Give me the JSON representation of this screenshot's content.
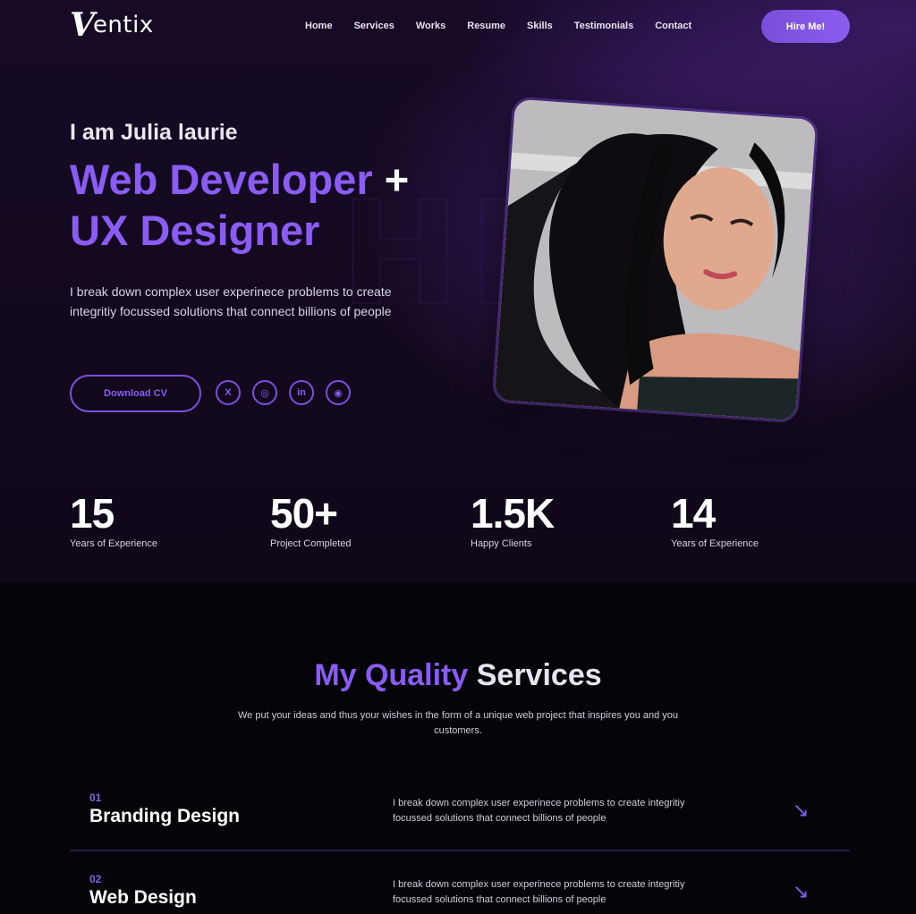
{
  "brand": {
    "logo_mark": "V",
    "logo_text": "entix"
  },
  "nav": {
    "items": [
      "Home",
      "Services",
      "Works",
      "Resume",
      "Skills",
      "Testimonials",
      "Contact"
    ],
    "cta": "Hire Me!"
  },
  "hero": {
    "intro": "I am Julia laurie",
    "headline_line1": "Web Developer",
    "headline_plus": "+",
    "headline_line2": "UX Designer",
    "description": "I break down complex user experinece problems to create integritiy focussed solutions that connect billions of people",
    "cv_button": "Download CV",
    "socials": [
      {
        "icon": "x-icon",
        "glyph": "X"
      },
      {
        "icon": "dribbble-icon",
        "glyph": "◎"
      },
      {
        "icon": "linkedin-icon",
        "glyph": "in"
      },
      {
        "icon": "github-icon",
        "glyph": "◉"
      }
    ],
    "photo_alt": "Portrait photo"
  },
  "stats": [
    {
      "value": "15",
      "label": "Years of Experience"
    },
    {
      "value": "50+",
      "label": "Project Completed"
    },
    {
      "value": "1.5K",
      "label": "Happy Clients"
    },
    {
      "value": "14",
      "label": "Years of Experience"
    }
  ],
  "services": {
    "title_accent": "My Quality",
    "title_rest": "Services",
    "subtitle": "We put your ideas and thus your wishes in the form of a unique web project that inspires you and you customers.",
    "items": [
      {
        "num": "01",
        "title": "Branding Design",
        "desc": "I break down complex user experinece problems to create integritiy focussed solutions that connect billions of people",
        "arrow": "↘"
      },
      {
        "num": "02",
        "title": "Web Design",
        "desc": "I break down complex user experinece problems to create integritiy focussed solutions that connect billions of people",
        "arrow": "↘"
      }
    ]
  },
  "colors": {
    "accent": "#8a5cf4",
    "hero_bg": "#160a26",
    "page_bg": "#050409"
  }
}
